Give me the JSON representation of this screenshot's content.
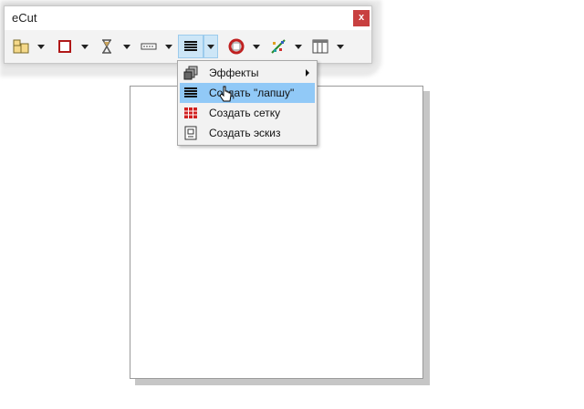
{
  "window": {
    "title": "eCut",
    "close_label": "x"
  },
  "toolbar": {
    "buttons": [
      {
        "icon": "layout-icon"
      },
      {
        "icon": "rectangle-icon"
      },
      {
        "icon": "hourglass-icon"
      },
      {
        "icon": "dotted-line-icon"
      },
      {
        "icon": "lines-icon",
        "active": true
      },
      {
        "icon": "lifebuoy-icon"
      },
      {
        "icon": "scatter-icon"
      },
      {
        "icon": "table-icon"
      }
    ]
  },
  "menu": {
    "items": [
      {
        "label": "Эффекты",
        "icon": "effects-icon",
        "submenu": true
      },
      {
        "label": "Создать \"лапшу\"",
        "icon": "lines-icon",
        "highlighted": true
      },
      {
        "label": "Создать сетку",
        "icon": "grid-icon"
      },
      {
        "label": "Создать эскиз",
        "icon": "sketch-icon"
      }
    ]
  },
  "colors": {
    "accent_highlight": "#91c9f7",
    "close_button": "#c84040",
    "grid_icon": "#d02020"
  }
}
